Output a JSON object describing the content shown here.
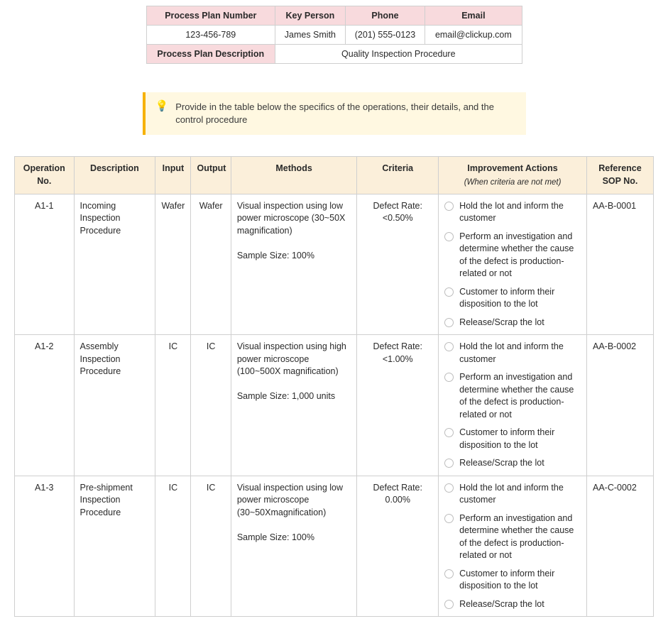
{
  "header": {
    "labels": {
      "plan_number": "Process Plan Number",
      "key_person": "Key Person",
      "phone": "Phone",
      "email": "Email",
      "description": "Process Plan Description"
    },
    "values": {
      "plan_number": "123-456-789",
      "key_person": "James Smith",
      "phone": "(201) 555-0123",
      "email": "email@clickup.com",
      "description": "Quality Inspection Procedure"
    }
  },
  "callout": {
    "icon": "💡",
    "text": "Provide in the table below the specifics of the operations, their details, and the control procedure"
  },
  "ops_table": {
    "headers": {
      "op_no": "Operation No.",
      "description": "Description",
      "input": "Input",
      "output": "Output",
      "methods": "Methods",
      "criteria": "Criteria",
      "improvement": "Improvement Actions",
      "improvement_sub": "(When criteria are not met)",
      "reference": "Reference SOP No."
    },
    "rows": [
      {
        "op_no": "A1-1",
        "description": "Incoming Inspection Procedure",
        "input": "Wafer",
        "output": "Wafer",
        "methods": "Visual inspection using low power microscope (30~50X magnification)\n\nSample Size: 100%",
        "criteria": "Defect Rate:\n<0.50%",
        "improvement": [
          "Hold the lot and inform the customer",
          "Perform an investigation and determine whether the cause of the defect is production-related or not",
          "Customer to inform their disposition to the lot",
          "Release/Scrap the lot"
        ],
        "reference": "AA-B-0001"
      },
      {
        "op_no": "A1-2",
        "description": "Assembly Inspection Procedure",
        "input": "IC",
        "output": "IC",
        "methods": "Visual inspection using high power microscope (100~500X magnification)\n\nSample Size: 1,000 units",
        "criteria": "Defect Rate:\n<1.00%",
        "improvement": [
          "Hold the lot and inform the customer",
          "Perform an investigation and determine whether the cause of the defect is production-related or not",
          "Customer to inform their disposition to the lot",
          "Release/Scrap the lot"
        ],
        "reference": "AA-B-0002"
      },
      {
        "op_no": "A1-3",
        "description": "Pre-shipment Inspection Procedure",
        "input": "IC",
        "output": "IC",
        "methods": "Visual inspection using low power microscope (30~50Xmagnification)\n\nSample Size: 100%",
        "criteria": "Defect Rate:\n0.00%",
        "improvement": [
          "Hold the lot and inform the customer",
          "Perform an investigation and determine whether the cause of the defect is production-related or not",
          "Customer to inform their disposition to the lot",
          "Release/Scrap the lot"
        ],
        "reference": "AA-C-0002"
      }
    ]
  }
}
